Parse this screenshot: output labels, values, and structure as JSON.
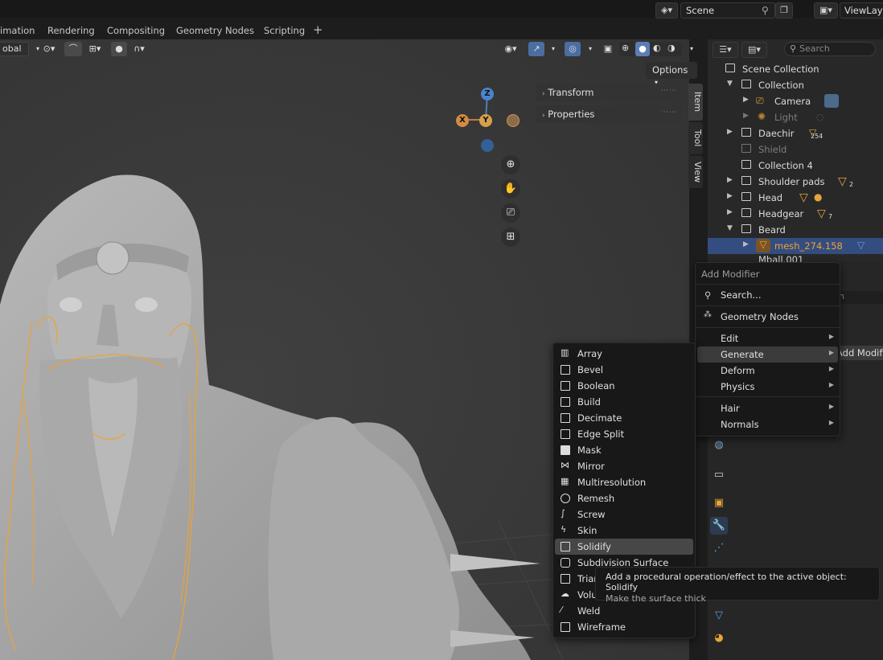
{
  "tabs": [
    "imation",
    "Rendering",
    "Compositing",
    "Geometry Nodes",
    "Scripting"
  ],
  "scene": "Scene",
  "view_layer": "ViewLayer",
  "viewport": {
    "transform_orientation": "obal",
    "options_label": "Options",
    "npanel": [
      "Transform",
      "Properties"
    ],
    "side_tabs": [
      "Item",
      "Tool",
      "View"
    ],
    "gizmo": {
      "x": "X",
      "y": "Y",
      "z": "Z"
    }
  },
  "outliner": {
    "search_placeholder": "Search",
    "rows": [
      {
        "label": "Scene Collection"
      },
      {
        "label": "Collection"
      },
      {
        "label": "Camera"
      },
      {
        "label": "Light"
      },
      {
        "label": "Daechir",
        "count": "254"
      },
      {
        "label": "Shield"
      },
      {
        "label": "Collection 4"
      },
      {
        "label": "Shoulder pads",
        "count": "2"
      },
      {
        "label": "Head"
      },
      {
        "label": "Headgear",
        "count": "7"
      },
      {
        "label": "Beard"
      },
      {
        "label": "mesh_274.158"
      },
      {
        "label": "Mball.001"
      }
    ]
  },
  "add_modifier": {
    "title": "Add Modifier",
    "search": "Search...",
    "geometry_nodes": "Geometry Nodes",
    "items": [
      "Edit",
      "Generate",
      "Deform",
      "Physics",
      "Hair",
      "Normals"
    ],
    "behind_button": "Add Modifier",
    "behind_search": "h"
  },
  "generate_items": [
    "Array",
    "Bevel",
    "Boolean",
    "Build",
    "Decimate",
    "Edge Split",
    "Mask",
    "Mirror",
    "Multiresolution",
    "Remesh",
    "Screw",
    "Skin",
    "Solidify",
    "Subdivision Surface",
    "Triangulate",
    "Volume to Mesh",
    "Weld",
    "Wireframe"
  ],
  "tooltip": {
    "line1": "Add a procedural operation/effect to the active object:  Solidify",
    "line2": "Make the surface thick"
  },
  "colors": {
    "accent": "#4a6ea0",
    "selection": "#334d80",
    "orange": "#e8a33c"
  }
}
